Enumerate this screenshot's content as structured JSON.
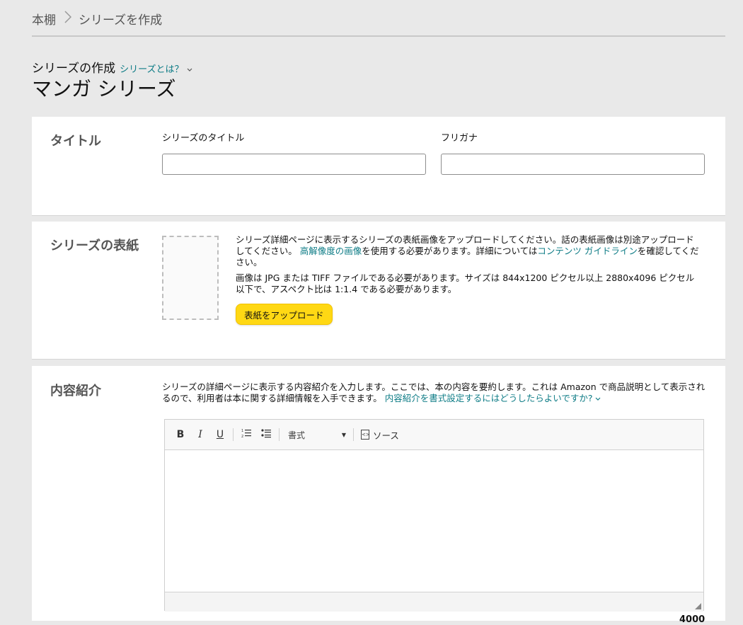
{
  "breadcrumb": {
    "root": "本棚",
    "current": "シリーズを作成"
  },
  "header": {
    "subtitle": "シリーズの作成",
    "help_link": "シリーズとは？",
    "title": "マンガ シリーズ"
  },
  "title_section": {
    "heading": "タイトル",
    "series_title_label": "シリーズのタイトル",
    "series_title_value": "",
    "furigana_label": "フリガナ",
    "furigana_value": ""
  },
  "cover_section": {
    "heading": "シリーズの表紙",
    "p1_a": "シリーズ詳細ページに表示するシリーズの表紙画像をアップロードしてください。話の表紙画像は別途アップロードしてください。 ",
    "p1_link1": "高解像度の画像",
    "p1_b": "を使用する必要があります。詳細については",
    "p1_link2": "コンテンツ ガイドライン",
    "p1_c": "を確認してください。",
    "p2": "画像は JPG または TIFF ファイルである必要があります。サイズは 844x1200 ピクセル以上 2880x4096 ピクセル以下で、アスペクト比は 1:1.4 である必要があります。",
    "upload_button": "表紙をアップロード"
  },
  "description_section": {
    "heading": "内容紹介",
    "text": "シリーズの詳細ページに表示する内容紹介を入力します。ここでは、本の内容を要約します。これは Amazon で商品説明として表示されるので、利用者は本に関する詳細情報を入手できます。 ",
    "help_link": "内容紹介を書式設定するにはどうしたらよいですか?",
    "toolbar": {
      "bold": "B",
      "italic": "I",
      "underline": "U",
      "format_label": "書式",
      "source_label": "ソース"
    },
    "counter": "4000"
  }
}
